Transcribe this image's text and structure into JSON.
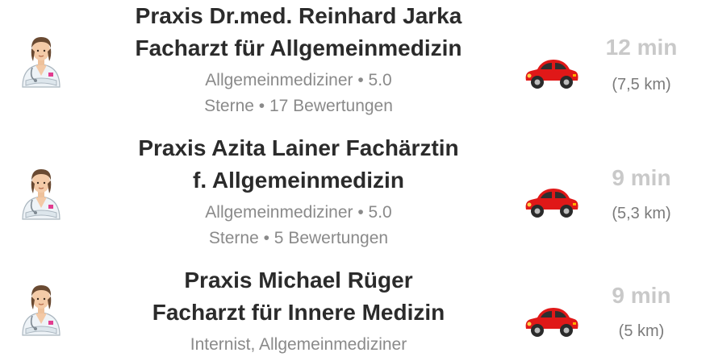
{
  "results": [
    {
      "name_line1": "Praxis Dr.med. Reinhard Jarka",
      "name_line2": "Facharzt für Allgemeinmedizin",
      "meta_line1": "Allgemeinmediziner • 5.0",
      "meta_line2": "Sterne • 17 Bewertungen",
      "time": "12 min",
      "distance": "(7,5 km)",
      "avatar_icon": "doctor-icon",
      "travel_icon": "car-icon"
    },
    {
      "name_line1": "Praxis Azita Lainer Fachärztin",
      "name_line2": "f. Allgemeinmedizin",
      "meta_line1": "Allgemeinmediziner • 5.0",
      "meta_line2": "Sterne • 5 Bewertungen",
      "time": "9 min",
      "distance": "(5,3 km)",
      "avatar_icon": "doctor-icon",
      "travel_icon": "car-icon"
    },
    {
      "name_line1": "Praxis Michael Rüger",
      "name_line2": "Facharzt für Innere Medizin",
      "meta_line1": "Internist, Allgemeinmediziner",
      "time": "9 min",
      "distance": "(5 km)",
      "avatar_icon": "doctor-icon",
      "travel_icon": "car-icon"
    }
  ],
  "colors": {
    "name_text": "#2b2b2b",
    "meta_text": "#8a8a8a",
    "time_text": "#c9c9c9",
    "car_body": "#e01818"
  }
}
